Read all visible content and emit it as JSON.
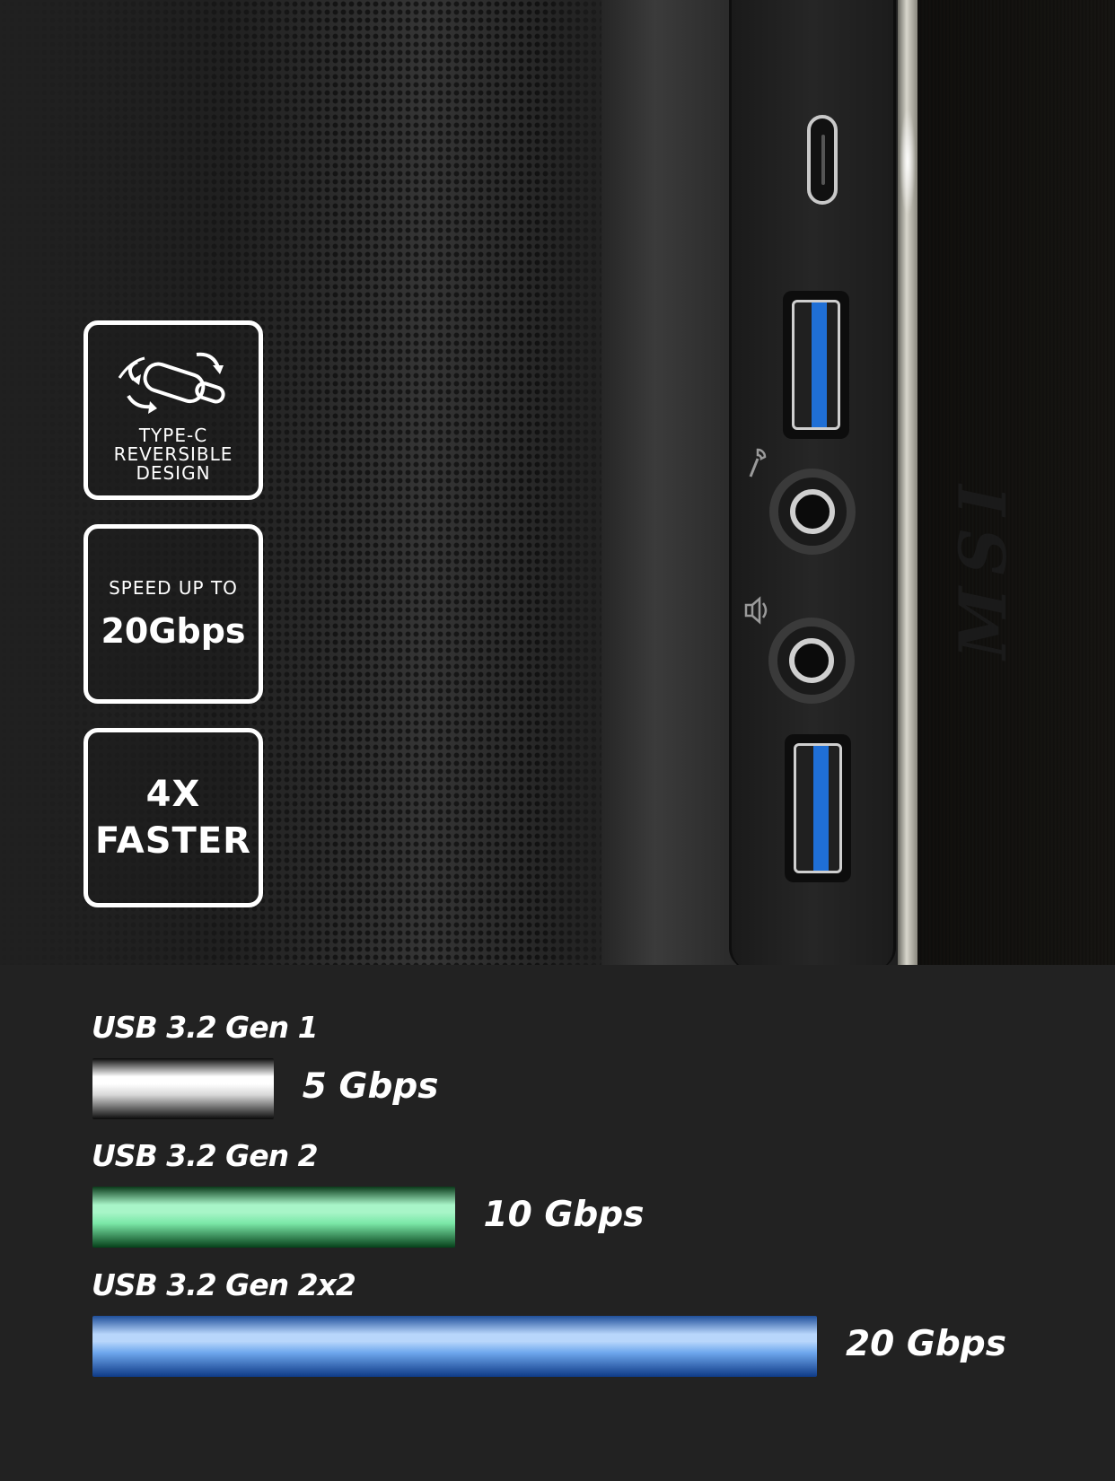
{
  "badges": {
    "reversible": {
      "line1": "TYPE-C",
      "line2": "REVERSIBLE",
      "line3": "DESIGN"
    },
    "speed": {
      "small": "SPEED UP TO",
      "big": "20Gbps"
    },
    "faster": {
      "line1": "4X",
      "line2": "FASTER"
    }
  },
  "brand_mark": "MSI",
  "chart_data": {
    "type": "bar",
    "orientation": "horizontal",
    "categories": [
      "USB 3.2 Gen 1",
      "USB 3.2 Gen 2",
      "USB 3.2 Gen 2x2"
    ],
    "values": [
      5,
      10,
      20
    ],
    "value_labels": [
      "5 Gbps",
      "10 Gbps",
      "20 Gbps"
    ],
    "unit": "Gbps",
    "xlim": [
      0,
      20
    ],
    "grid": false,
    "colors": [
      "#d8d8d8",
      "#7be8a8",
      "#6fa8ee"
    ]
  }
}
